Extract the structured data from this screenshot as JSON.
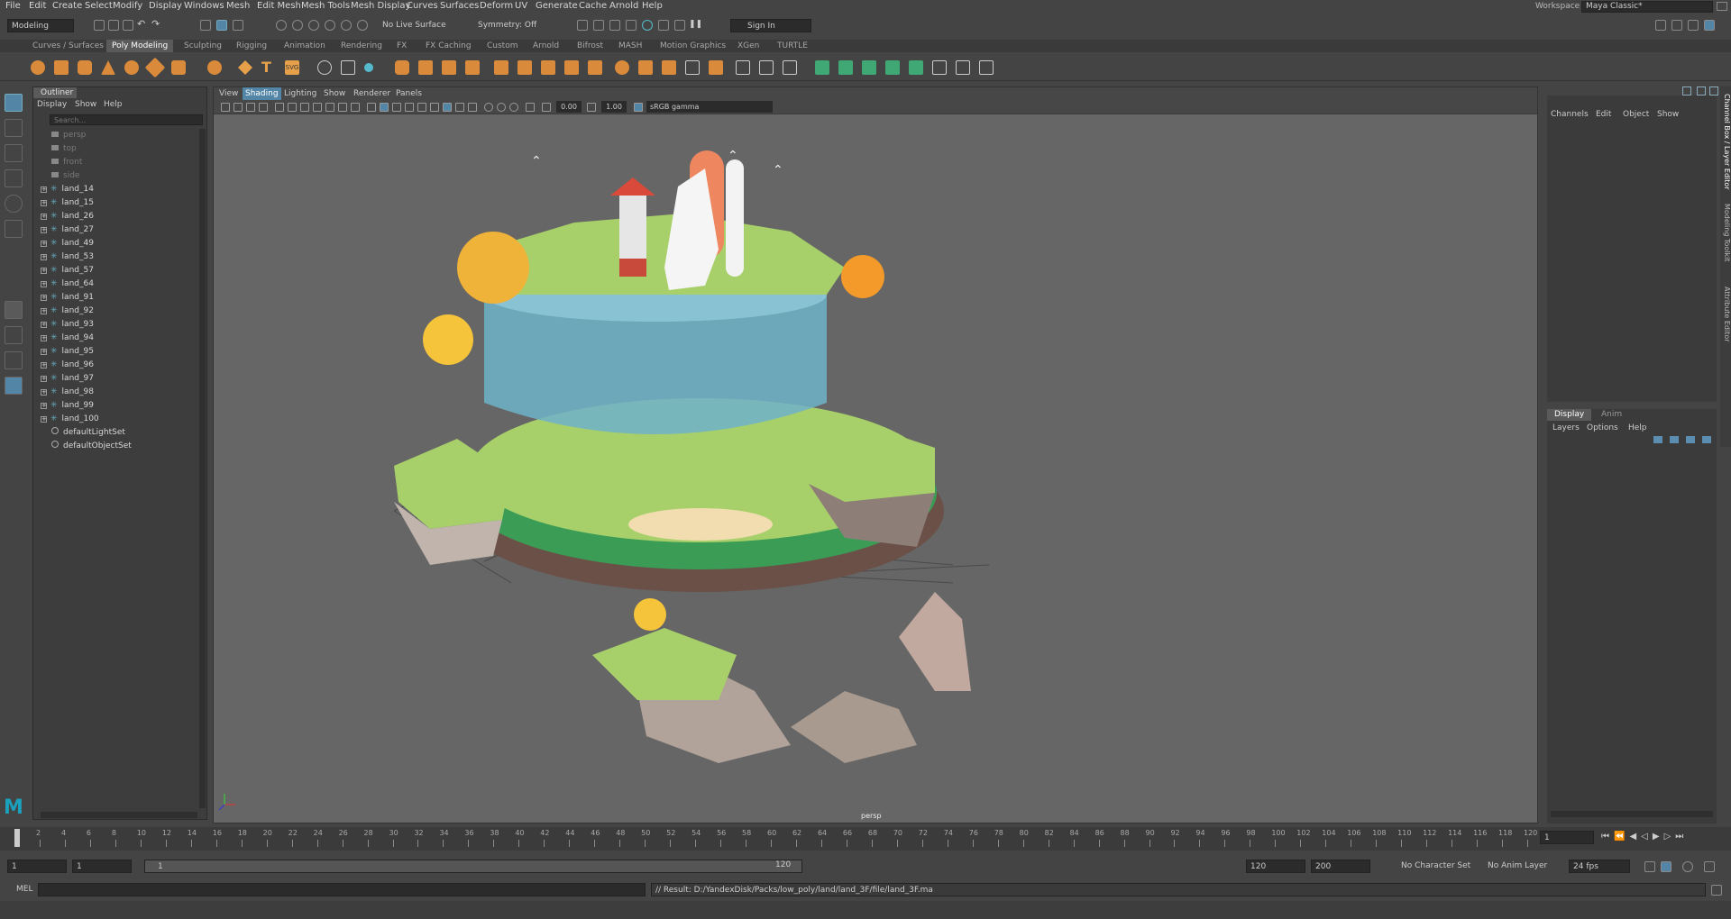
{
  "menubar": {
    "items": [
      "File",
      "Edit",
      "Create",
      "Select",
      "Modify",
      "Display",
      "Windows",
      "Mesh",
      "Edit Mesh",
      "Mesh Tools",
      "Mesh Display",
      "Curves",
      "Surfaces",
      "Deform",
      "UV",
      "Generate",
      "Cache",
      "Arnold",
      "Help"
    ],
    "workspace_label": "Workspace :",
    "workspace_value": "Maya Classic*"
  },
  "statusline": {
    "mode": "Modeling",
    "live_surface": "No Live Surface",
    "symmetry": "Symmetry: Off",
    "sign_in": "Sign In"
  },
  "shelf": {
    "tabs": [
      "Curves / Surfaces",
      "Poly Modeling",
      "Sculpting",
      "Rigging",
      "Animation",
      "Rendering",
      "FX",
      "FX Caching",
      "Custom",
      "Arnold",
      "Bifrost",
      "MASH",
      "Motion Graphics",
      "XGen",
      "TURTLE"
    ],
    "active_tab": "Poly Modeling"
  },
  "outliner": {
    "title": "Outliner",
    "menu": [
      "Display",
      "Show",
      "Help"
    ],
    "search_placeholder": "Search...",
    "cameras": [
      "persp",
      "top",
      "front",
      "side"
    ],
    "items": [
      "land_14",
      "land_15",
      "land_26",
      "land_27",
      "land_49",
      "land_53",
      "land_57",
      "land_64",
      "land_91",
      "land_92",
      "land_93",
      "land_94",
      "land_95",
      "land_96",
      "land_97",
      "land_98",
      "land_99",
      "land_100"
    ],
    "sets": [
      "defaultLightSet",
      "defaultObjectSet"
    ]
  },
  "viewport": {
    "menu": [
      "View",
      "Shading",
      "Lighting",
      "Show",
      "Renderer",
      "Panels"
    ],
    "active_menu": "Shading",
    "exposure": "0.00",
    "gamma": "1.00",
    "color_space": "sRGB gamma",
    "camera_label": "persp"
  },
  "channelbox": {
    "menu": [
      "Channels",
      "Edit",
      "Object",
      "Show"
    ],
    "side_tabs": [
      "Channel Box / Layer Editor",
      "Modeling Toolkit",
      "Attribute Editor"
    ]
  },
  "layereditor": {
    "tabs": [
      "Display",
      "Anim"
    ],
    "active_tab": "Display",
    "menu": [
      "Layers",
      "Options",
      "Help"
    ]
  },
  "timeslider": {
    "ticks": [
      2,
      4,
      6,
      8,
      10,
      12,
      14,
      16,
      18,
      20,
      22,
      24,
      26,
      28,
      30,
      32,
      34,
      36,
      38,
      40,
      42,
      44,
      46,
      48,
      50,
      52,
      54,
      56,
      58,
      60,
      62,
      64,
      66,
      68,
      70,
      72,
      74,
      76,
      78,
      80,
      82,
      84,
      86,
      88,
      90,
      92,
      94,
      96,
      98,
      100,
      102,
      104,
      106,
      108,
      110,
      112,
      114,
      116,
      118,
      120
    ],
    "current_frame_left": "1",
    "current_frame": "1"
  },
  "rangeslider": {
    "start": "1",
    "anim_start": "1",
    "range_start": "1",
    "range_end": "120",
    "anim_end": "120",
    "end": "200",
    "character_set": "No Character Set",
    "anim_layer": "No Anim Layer",
    "fps": "24 fps"
  },
  "cmdline": {
    "label": "MEL",
    "result": "// Result: D:/YandexDisk/Packs/low_poly/land/land_3F/file/land_3F.ma"
  },
  "colors": {
    "accent": "#5285a6",
    "panel": "#444444",
    "viewport_bg": "#666666",
    "shelf_icon": "#d98a3a",
    "shelf_icon_green": "#3fa874",
    "maya_logo": "#1ba1bd"
  }
}
